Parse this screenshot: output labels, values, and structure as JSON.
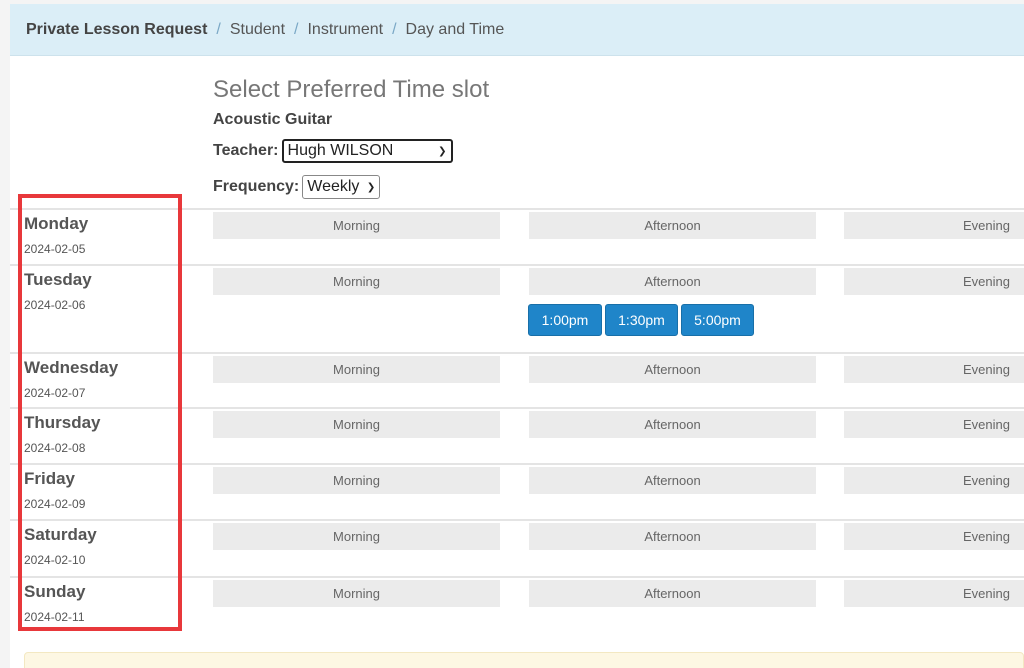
{
  "breadcrumb": {
    "current": "Private Lesson Request",
    "items": [
      "Student",
      "Instrument",
      "Day and Time"
    ],
    "separator": "/"
  },
  "heading": "Select Preferred Time slot",
  "instrument": "Acoustic Guitar",
  "teacher": {
    "label": "Teacher:",
    "value": "Hugh WILSON"
  },
  "frequency": {
    "label": "Frequency:",
    "value": "Weekly"
  },
  "periods": [
    "Morning",
    "Afternoon",
    "Evening"
  ],
  "days": [
    {
      "name": "Monday",
      "date": "2024-02-05",
      "slots": []
    },
    {
      "name": "Tuesday",
      "date": "2024-02-06",
      "slots": [
        "1:00pm",
        "1:30pm",
        "5:00pm"
      ]
    },
    {
      "name": "Wednesday",
      "date": "2024-02-07",
      "slots": []
    },
    {
      "name": "Thursday",
      "date": "2024-02-08",
      "slots": []
    },
    {
      "name": "Friday",
      "date": "2024-02-09",
      "slots": []
    },
    {
      "name": "Saturday",
      "date": "2024-02-10",
      "slots": []
    },
    {
      "name": "Sunday",
      "date": "2024-02-11",
      "slots": []
    }
  ],
  "colors": {
    "breadcrumb_bg": "#dbeef7",
    "slot_button": "#1f85c9",
    "highlight": "#e8383b",
    "notice_bg": "#fdf7e3"
  }
}
